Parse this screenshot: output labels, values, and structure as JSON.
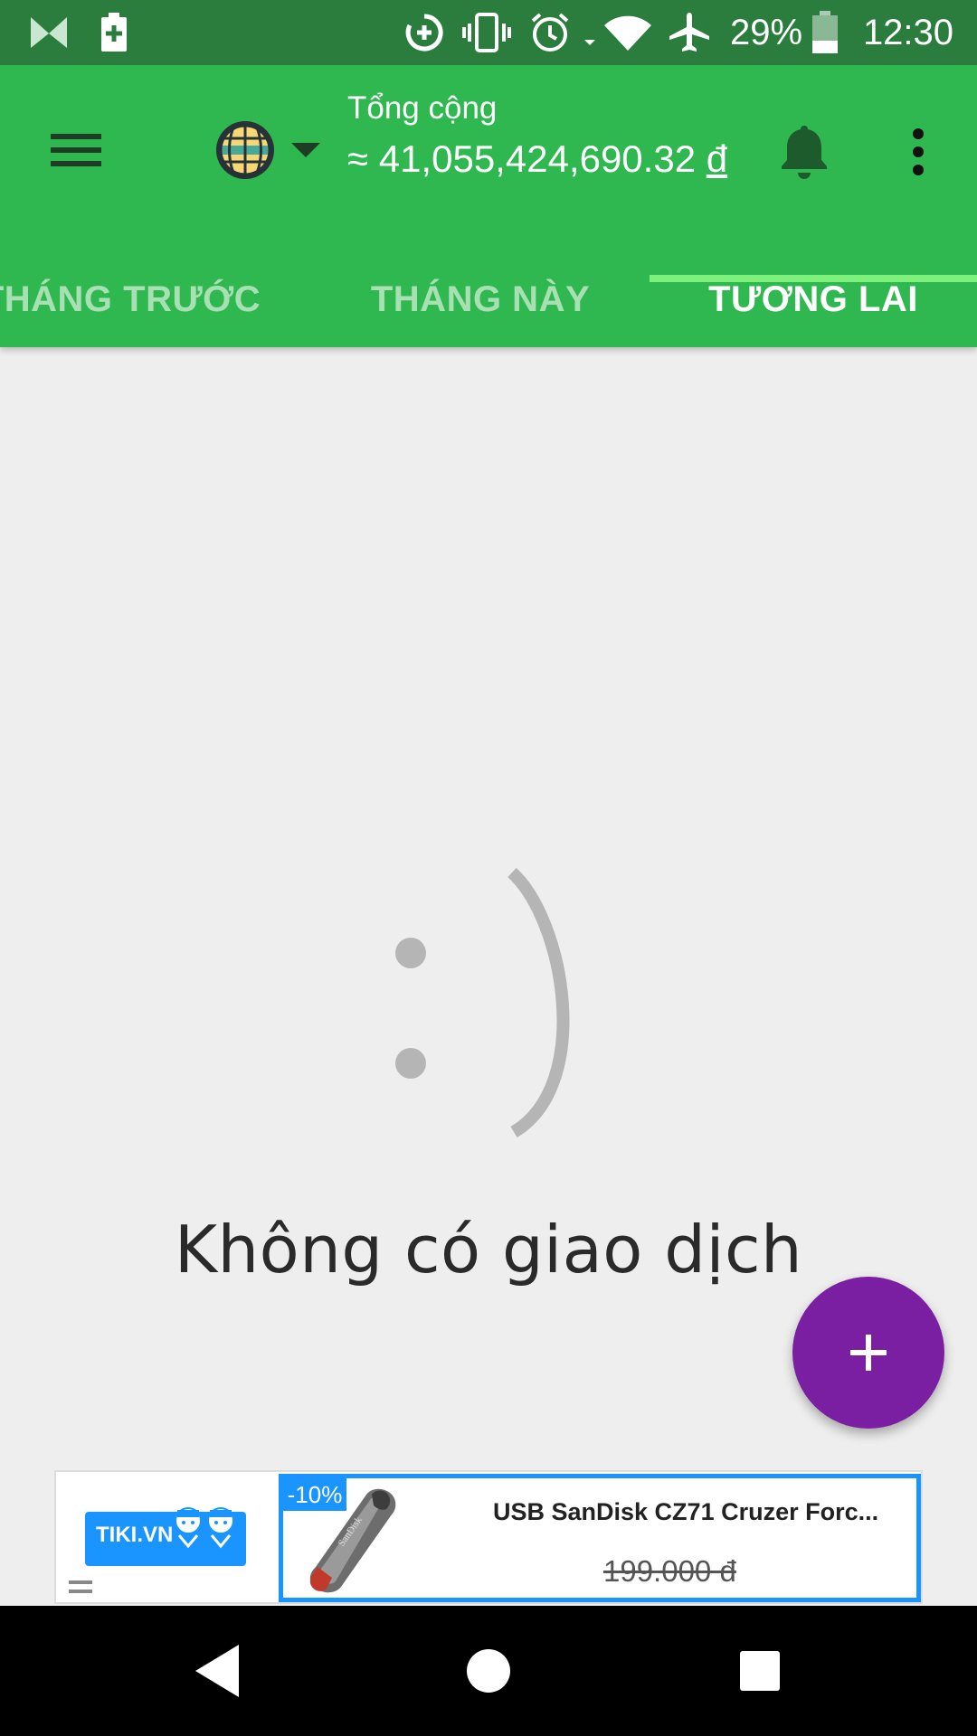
{
  "status_bar": {
    "battery_percent": "29%",
    "time": "12:30"
  },
  "header": {
    "total_label": "Tổng cộng",
    "total_amount": "≈ 41,055,424,690.32",
    "currency_symbol": "đ"
  },
  "tabs": [
    {
      "label": "THÁNG TRƯỚC"
    },
    {
      "label": "THÁNG NÀY"
    },
    {
      "label": "TƯƠNG LAI"
    }
  ],
  "empty_state": {
    "message": "Không có giao dịch"
  },
  "ad": {
    "brand_logo": "TIKI.VN",
    "discount_badge": "-10%",
    "product_title": "USB SanDisk CZ71 Cruzer Forc...",
    "old_price": "199.000 đ"
  },
  "colors": {
    "status_bar": "#2b7d3d",
    "app_bar": "#2fb84f",
    "tab_indicator": "#7ef07c",
    "fab": "#7b1fa2",
    "ad_accent": "#1a94ff"
  }
}
